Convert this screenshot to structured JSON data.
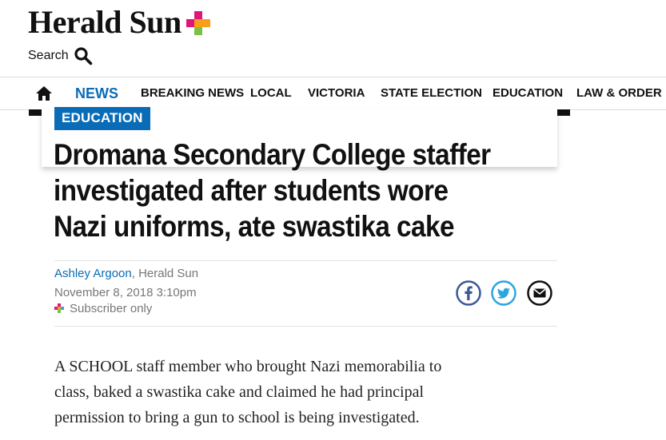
{
  "header": {
    "logo_text": "Herald Sun",
    "search_label": "Search"
  },
  "nav": {
    "items": [
      {
        "label": "NEWS",
        "active": true
      },
      {
        "label": "BREAKING NEWS"
      },
      {
        "label": "LOCAL"
      },
      {
        "label": "VICTORIA"
      },
      {
        "label": "STATE ELECTION"
      },
      {
        "label": "EDUCATION"
      },
      {
        "label": "LAW & ORDER"
      }
    ]
  },
  "article": {
    "section": "EDUCATION",
    "headline_lines": [
      "Dromana Secondary College staffer",
      "investigated after students wore",
      "Nazi uniforms, ate swastika cake"
    ],
    "author": "Ashley Argoon",
    "publication": ", Herald Sun",
    "date": "November 8, 2018 3:10pm",
    "subscriber": "Subscriber only",
    "body_lines": [
      "A SCHOOL staff member who brought Nazi memorabilia to",
      "class, baked a swastika cake and claimed he had principal",
      "permission to bring a gun to school is being investigated."
    ]
  },
  "colors": {
    "accent": "#0a6cb6",
    "plus_magenta": "#e0157a",
    "plus_orange": "#f6a01a",
    "plus_green": "#7cc242",
    "plus_blue": "#2ba6de",
    "facebook": "#3b5998",
    "twitter": "#2ba6de"
  },
  "icons": [
    "home-icon",
    "search-icon",
    "facebook-icon",
    "twitter-icon",
    "email-icon"
  ]
}
